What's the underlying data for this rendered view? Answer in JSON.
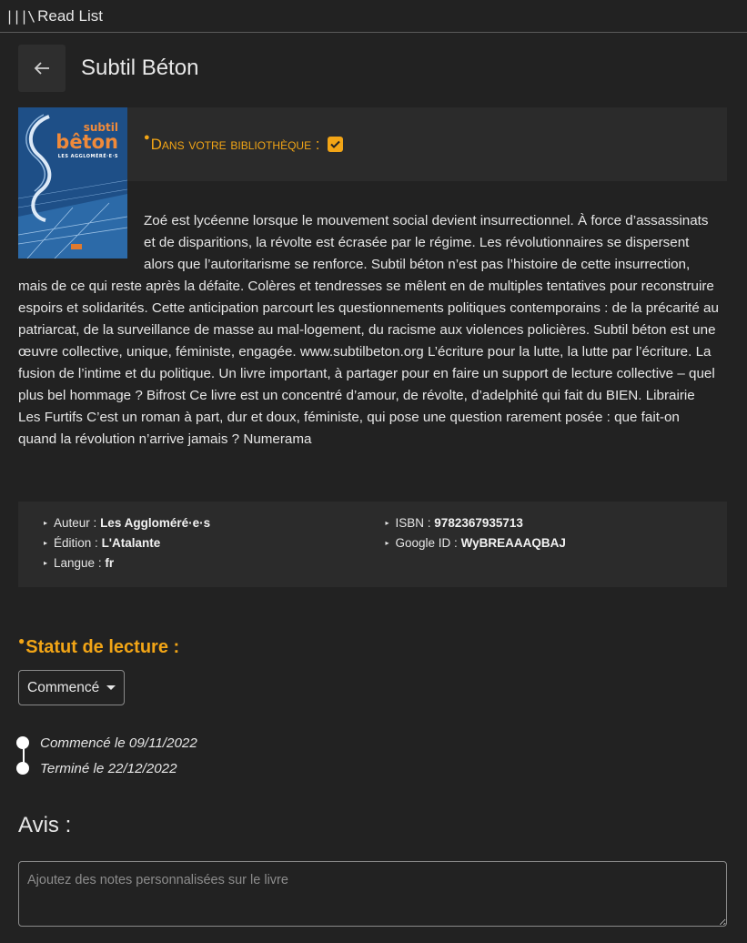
{
  "app": {
    "logo_glyph": "|||\\",
    "title": "Read List"
  },
  "book": {
    "title": "Subtil Béton",
    "cover": {
      "line1": "subtil",
      "line2": "bêton",
      "line3": "LES AGGLOMÉRÉ·E·S"
    },
    "library_label": "Dans votre bibliothèque :",
    "in_library": true,
    "description": "Zoé est lycéenne lorsque le mouvement social devient insurrectionnel. À force d’assassinats et de disparitions, la révolte est écrasée par le régime. Les révolutionnaires se dispersent alors que l’autoritarisme se renforce. Subtil béton n’est pas l’histoire de cette insurrection, mais de ce qui reste après la défaite. Colères et tendresses se mêlent en de multiples tentatives pour reconstruire espoirs et solidarités. Cette anticipation parcourt les questionnements politiques contemporains : de la précarité au patriarcat, de la surveillance de masse au mal-logement, du racisme aux violences policières. Subtil béton est une œuvre collective, unique, féministe, engagée. www.subtilbeton.org L’écriture pour la lutte, la lutte par l’écriture. La fusion de l’intime et du politique. Un livre important, à partager pour en faire un support de lecture collective – quel plus bel hommage ? Bifrost Ce livre est un concentré d’amour, de révolte, d’adelphité qui fait du BIEN. Librairie Les Furtifs C’est un roman à part, dur et doux, féministe, qui pose une question rarement posée : que fait-on quand la révolution n’arrive jamais ? Numerama"
  },
  "details": {
    "left": [
      {
        "label": "Auteur :",
        "value": "Les Aggloméré·e·s"
      },
      {
        "label": "Édition :",
        "value": "L'Atalante"
      },
      {
        "label": "Langue :",
        "value": "fr"
      }
    ],
    "right": [
      {
        "label": "ISBN :",
        "value": "9782367935713"
      },
      {
        "label": "Google ID :",
        "value": "WyBREAAAQBAJ"
      }
    ]
  },
  "reading": {
    "title": "Statut de lecture :",
    "status": "Commencé",
    "timeline": [
      {
        "text": "Commencé le 09/11/2022"
      },
      {
        "text": "Terminé le 22/12/2022"
      }
    ]
  },
  "review": {
    "title": "Avis :",
    "placeholder": "Ajoutez des notes personnalisées sur le livre",
    "value": ""
  },
  "colors": {
    "accent": "#f2a516",
    "background": "#222222",
    "panel": "#2b2b2b"
  }
}
